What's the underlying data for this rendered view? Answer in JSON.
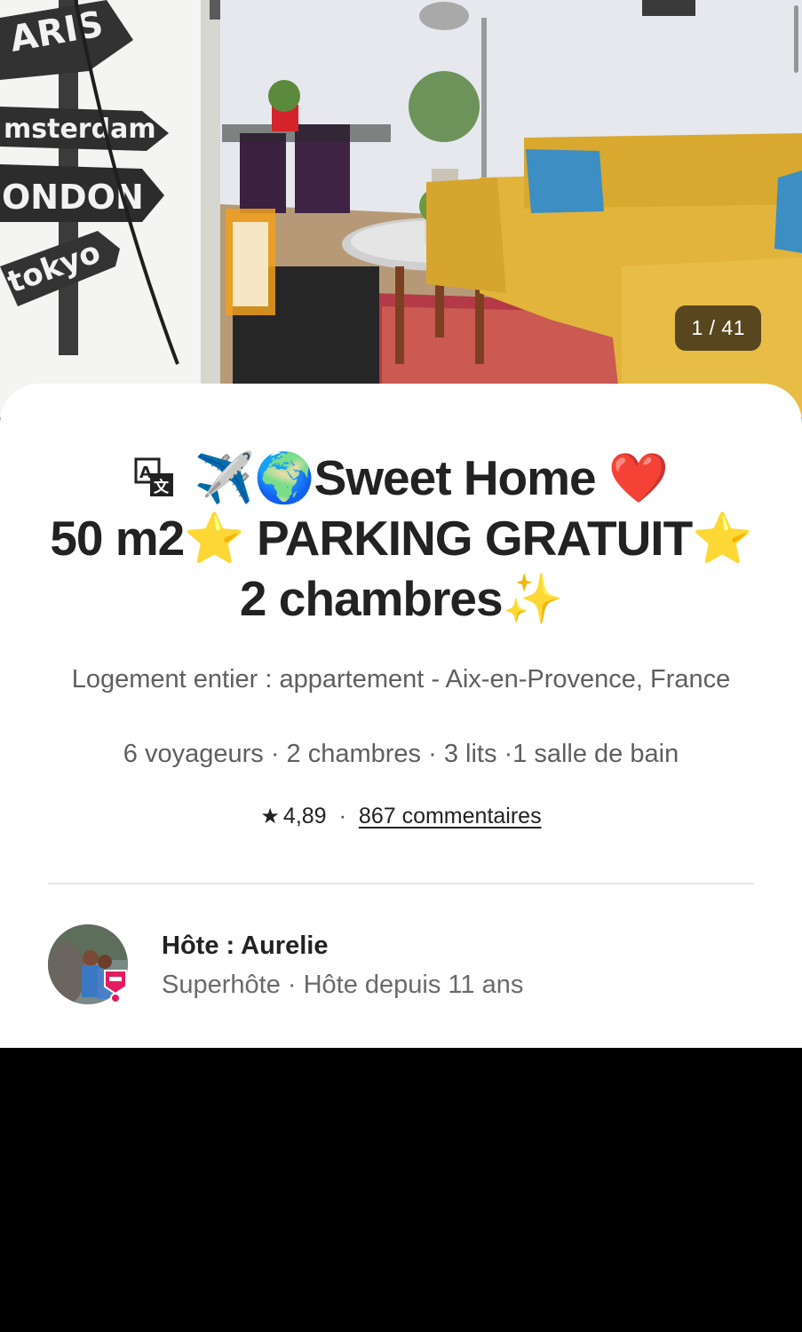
{
  "photo": {
    "counter": "1 / 41",
    "sign_labels": [
      "ARIS",
      "msterdam",
      "ONDON",
      "tokyo"
    ]
  },
  "listing": {
    "title_line1": "Sweet Home",
    "title_line2_a": "50 m2",
    "title_line2_b": "PARKING GRATUIT",
    "title_line3": "2 chambres",
    "emoji": {
      "plane": "✈️",
      "globe": "🌍",
      "heart": "❤️",
      "star": "⭐",
      "sparkles": "✨"
    },
    "subtitle": "Logement entier : appartement - Aix-en-Provence, France",
    "details": "6 voyageurs · 2 chambres · 3 lits ·1 salle de bain",
    "rating": "4,89",
    "rating_separator": "·",
    "reviews": "867 commentaires"
  },
  "host": {
    "name_label": "Hôte : Aurelie",
    "meta": "Superhôte · Hôte depuis 11 ans"
  },
  "colors": {
    "sofa": "#e2b43c",
    "superhost_badge": "#e31c5f",
    "counter_bg": "#382c16"
  },
  "icons": [
    "translate-icon",
    "star-icon",
    "superhost-badge-icon"
  ]
}
